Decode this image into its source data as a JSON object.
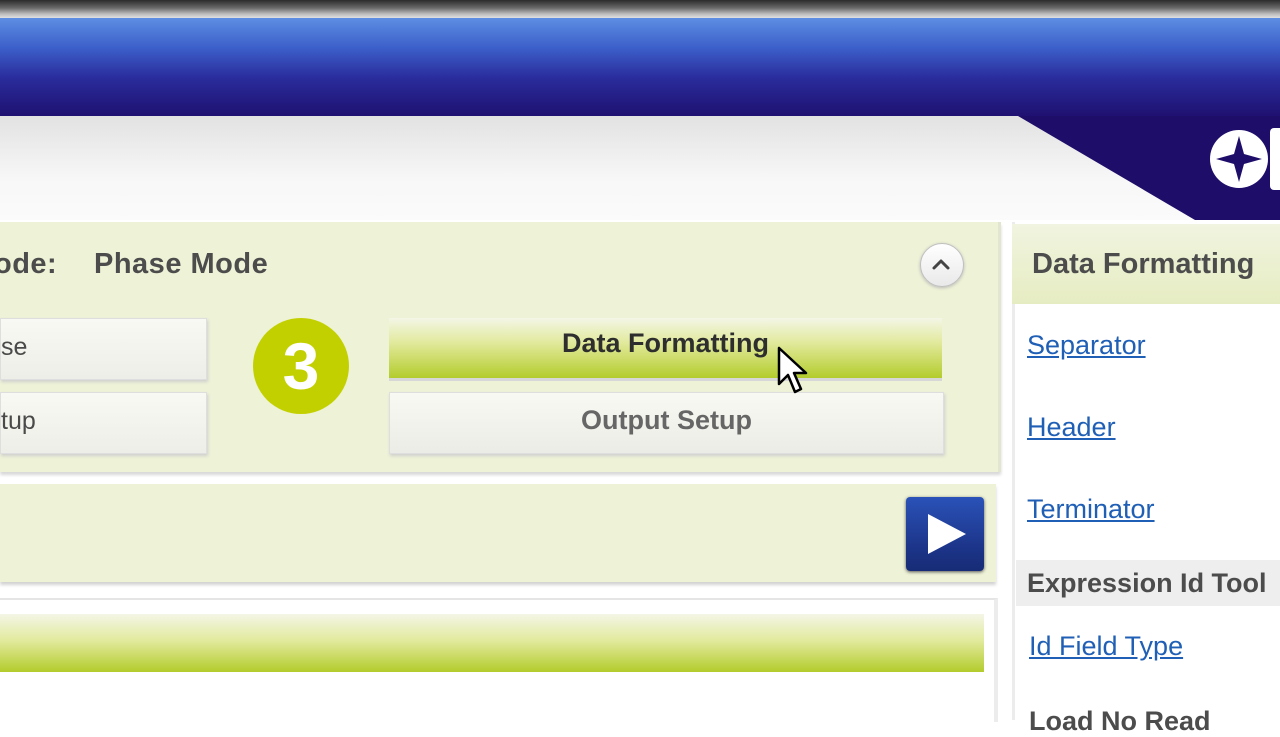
{
  "mode_section": {
    "mode_label": "ode:",
    "mode_value": "Phase Mode",
    "left_buttons": [
      "se",
      "tup"
    ],
    "step_number": "3",
    "tabs": [
      {
        "label": "Data Formatting",
        "active": true
      },
      {
        "label": "Output Setup",
        "active": false
      }
    ]
  },
  "right_panel": {
    "title": "Data Formatting",
    "links": [
      "Separator",
      "Header",
      "Terminator"
    ],
    "section_title": "Expression Id Tool",
    "section_links": [
      "Id Field Type"
    ],
    "next_item_cut": "Load No Read"
  },
  "colors": {
    "banner_blue": "#3c5fc9",
    "banner_navy": "#1f0d6a",
    "panel_bg": "#eef2d6",
    "accent_green": "#b4cc2c",
    "badge_green": "#c3d000",
    "play_blue": "#1c3488",
    "link_blue": "#1f5fb5"
  },
  "icons": {
    "collapse": "chevron-up-icon",
    "next": "play-icon",
    "logo": "star-logo-icon",
    "cursor": "mouse-pointer-icon"
  }
}
